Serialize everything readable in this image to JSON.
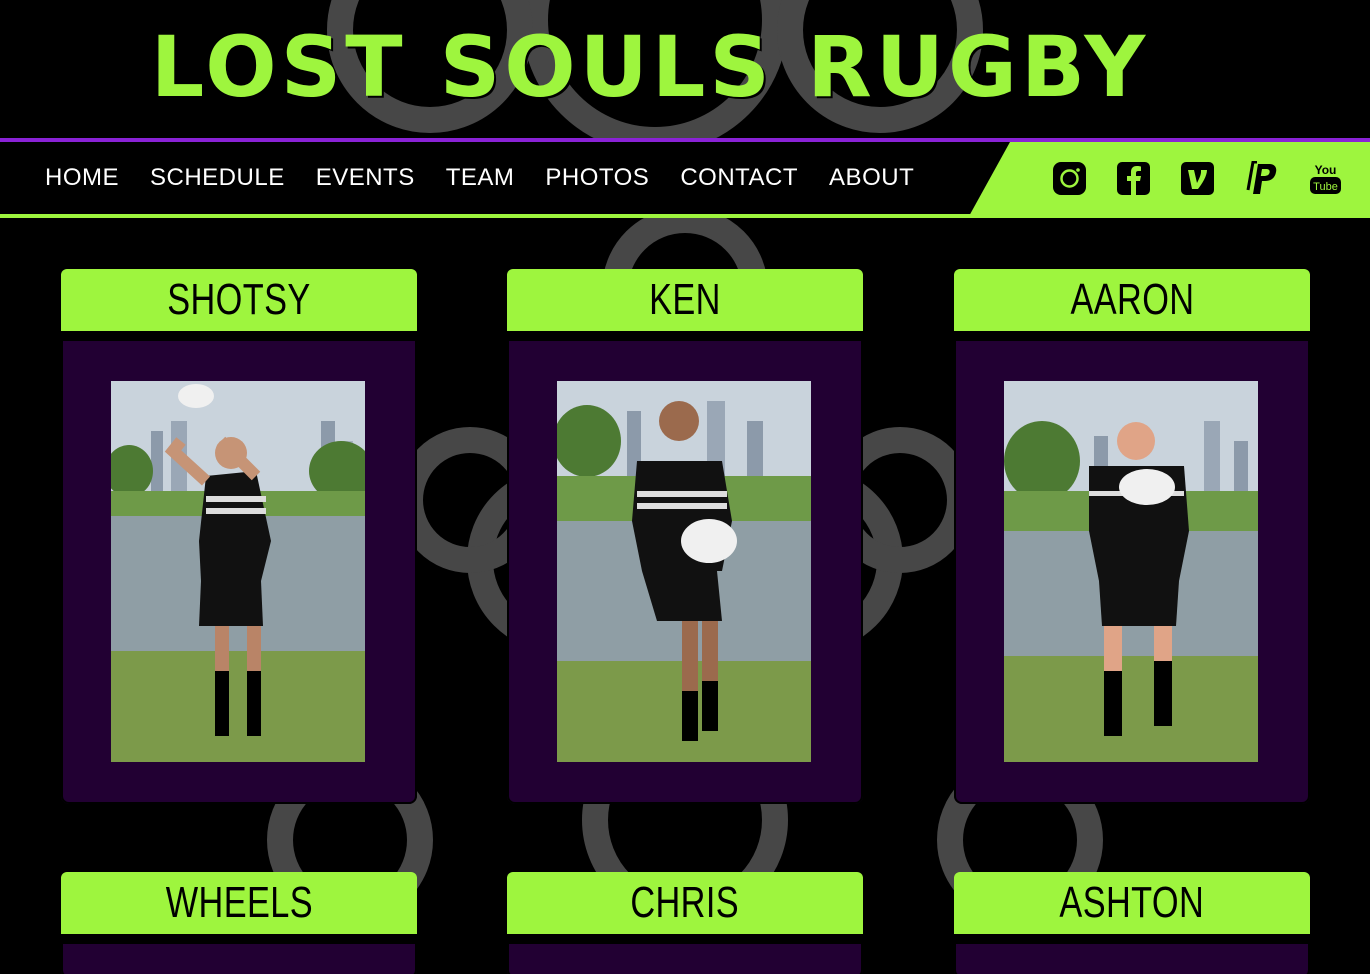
{
  "site": {
    "title": "LOST SOULS RUGBY"
  },
  "nav": {
    "items": [
      "HOME",
      "SCHEDULE",
      "EVENTS",
      "TEAM",
      "PHOTOS",
      "CONTACT",
      "ABOUT"
    ]
  },
  "social": {
    "icons": [
      "instagram-icon",
      "facebook-icon",
      "venmo-icon",
      "paypal-icon",
      "youtube-icon"
    ],
    "youtube_text": [
      "You",
      "Tube"
    ]
  },
  "team": {
    "players": [
      {
        "name": "SHOTSY"
      },
      {
        "name": "KEN"
      },
      {
        "name": "AARON"
      },
      {
        "name": "WHEELS"
      },
      {
        "name": "CHRIS"
      },
      {
        "name": "ASHTON"
      }
    ]
  },
  "colors": {
    "accent_green": "#9ef53e",
    "accent_purple": "#8a22d6",
    "card_bg": "#220033",
    "ornament": "#4a4a4a"
  }
}
